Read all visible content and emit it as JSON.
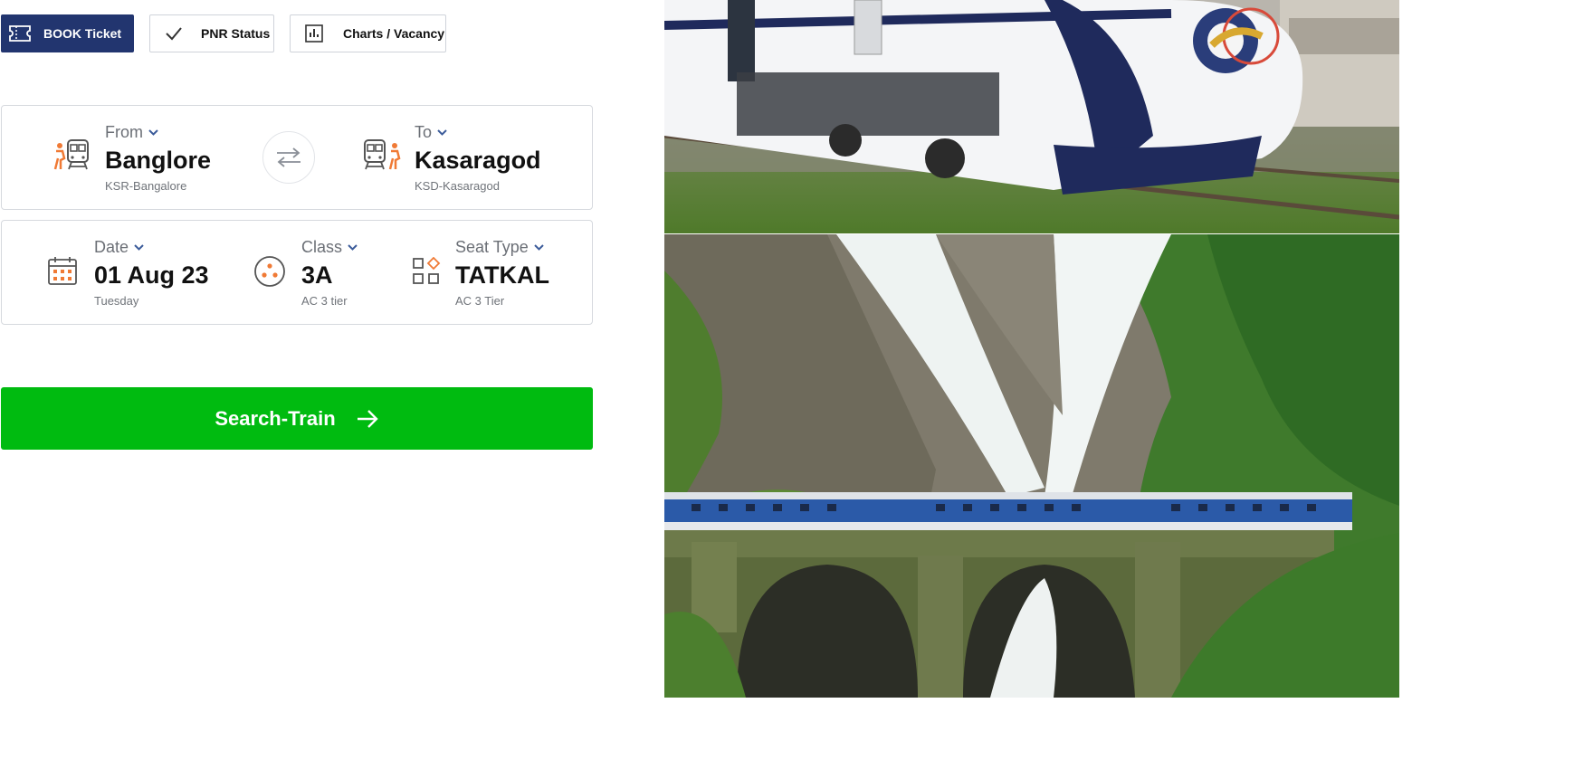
{
  "tabs": {
    "book": {
      "label": "BOOK Ticket",
      "icon": "ticket-icon"
    },
    "pnr": {
      "label": "PNR Status",
      "icon": "check-icon"
    },
    "charts": {
      "label": "Charts / Vacancy",
      "icon": "bar-chart-icon"
    }
  },
  "route": {
    "from": {
      "label": "From",
      "city": "Banglore",
      "station": "KSR-Bangalore",
      "icon": "train-passenger-icon"
    },
    "to": {
      "label": "To",
      "city": "Kasaragod",
      "station": "KSD-Kasaragod",
      "icon": "train-passenger-icon"
    },
    "swap_icon": "swap-arrows-icon"
  },
  "journey": {
    "date": {
      "label": "Date",
      "value": "01 Aug 23",
      "sub": "Tuesday",
      "icon": "calendar-icon"
    },
    "class": {
      "label": "Class",
      "value": "3A",
      "sub": "AC 3 tier",
      "icon": "class-seat-icon"
    },
    "seat_type": {
      "label": "Seat Type",
      "value": "TATKAL",
      "sub": "AC 3 Tier",
      "icon": "grid-apps-icon"
    }
  },
  "search": {
    "label": "Search-Train",
    "icon": "arrow-right-icon"
  },
  "colors": {
    "primary": "#22356f",
    "accent_orange": "#f07a35",
    "search_green": "#00bb10",
    "chevron_blue": "#3b5b9a"
  }
}
